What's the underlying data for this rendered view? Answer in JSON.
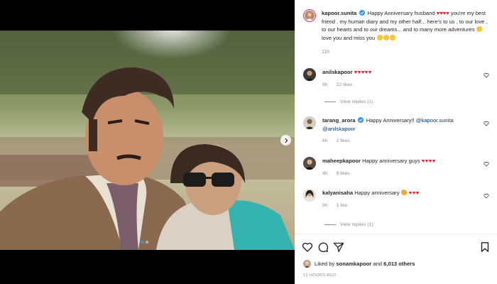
{
  "post": {
    "author": "kapoor.sunita",
    "caption_text": "Happy Anniversary husband",
    "caption_hearts": "♥♥♥♥",
    "caption_continue": "you're my best friend . my human diary and my other half... here's to us , to our love , to our hearts and to our dreams... and to many more adventures",
    "caption_end": "love you and miss you",
    "time": "11h",
    "accent_color": "#3897f0",
    "heart_color": "#ed1c24"
  },
  "comments": [
    {
      "username": "anilskapoor",
      "hearts": "♥♥♥♥♥",
      "text": "",
      "time": "6h",
      "likes": "22 likes",
      "view_replies": "View replies (1)"
    },
    {
      "username": "tarang_arora",
      "text": "Happy Anniversary!!",
      "mention1": "@kapoor.sunita",
      "mention2": "@anilskapoor",
      "time": "6h",
      "likes": "2 likes"
    },
    {
      "username": "maheepkapoor",
      "text": "Happy anniversary guys",
      "hearts": "♥♥♥♥",
      "time": "4h",
      "likes": "9 likes"
    },
    {
      "username": "kalyanisaha",
      "text": "Happy anniversary",
      "hearts": "♥♥♥",
      "time": "5h",
      "likes": "1 like",
      "view_replies": "View replies (1)"
    }
  ],
  "footer": {
    "liked_by_prefix": "Liked by",
    "liked_by_user": "sonamkapoor",
    "liked_by_and": "and",
    "liked_by_count": "6,013 others",
    "posted_ago": "12 HOURS AGO"
  },
  "icons": {
    "like": "heart-icon",
    "comment": "comment-icon",
    "share": "share-icon",
    "save": "bookmark-icon",
    "next": "chevron-right-icon",
    "verified": "verified-badge-icon"
  }
}
